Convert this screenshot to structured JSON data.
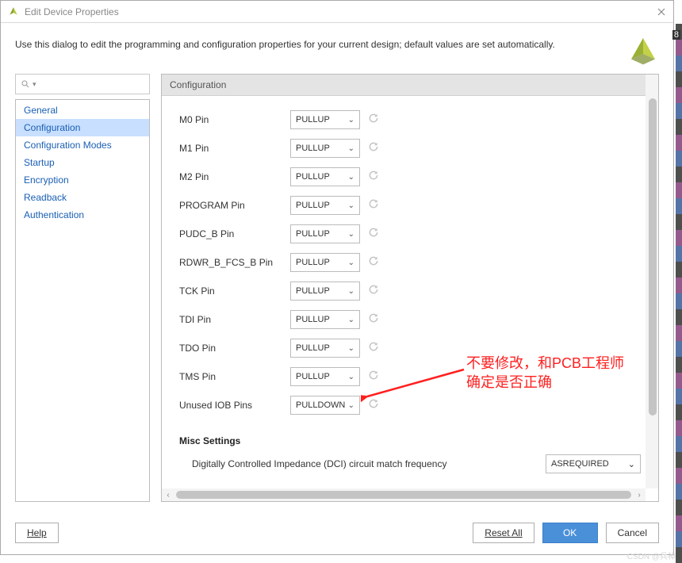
{
  "window": {
    "title": "Edit Device Properties",
    "description": "Use this dialog to edit the programming and configuration properties for your current design; default values are set automatically."
  },
  "sidebar": {
    "search_placeholder": "",
    "items": [
      {
        "label": "General"
      },
      {
        "label": "Configuration",
        "selected": true
      },
      {
        "label": "Configuration Modes"
      },
      {
        "label": "Startup"
      },
      {
        "label": "Encryption"
      },
      {
        "label": "Readback"
      },
      {
        "label": "Authentication"
      }
    ]
  },
  "content": {
    "header": "Configuration",
    "properties": [
      {
        "label": "M0 Pin",
        "value": "PULLUP"
      },
      {
        "label": "M1 Pin",
        "value": "PULLUP"
      },
      {
        "label": "M2 Pin",
        "value": "PULLUP"
      },
      {
        "label": "PROGRAM Pin",
        "value": "PULLUP"
      },
      {
        "label": "PUDC_B Pin",
        "value": "PULLUP"
      },
      {
        "label": "RDWR_B_FCS_B Pin",
        "value": "PULLUP"
      },
      {
        "label": "TCK Pin",
        "value": "PULLUP"
      },
      {
        "label": "TDI Pin",
        "value": "PULLUP"
      },
      {
        "label": "TDO Pin",
        "value": "PULLUP"
      },
      {
        "label": "TMS Pin",
        "value": "PULLUP"
      },
      {
        "label": "Unused IOB Pins",
        "value": "PULLDOWN"
      }
    ],
    "misc_header": "Misc Settings",
    "misc": {
      "label": "Digitally Controlled Impedance (DCI) circuit match frequency",
      "value": "ASREQUIRED"
    }
  },
  "footer": {
    "help": "Help",
    "reset_all": "Reset All",
    "ok": "OK",
    "cancel": "Cancel"
  },
  "annotation": {
    "line1": "不要修改，和PCB工程师",
    "line2": "确定是否正确"
  },
  "watermark": "CSDN @兵棹",
  "edge_num": "8"
}
